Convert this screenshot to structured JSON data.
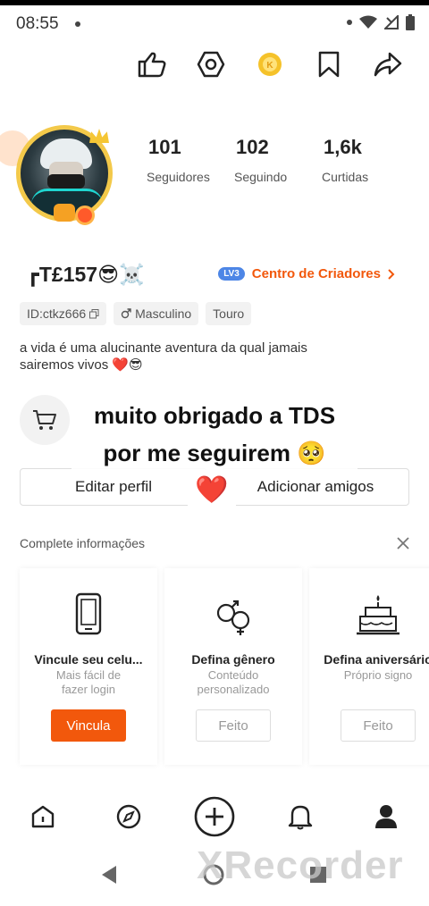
{
  "status_bar": {
    "time": "08:55"
  },
  "header": {
    "icons": [
      "thumbs-up-icon",
      "settings-hexagon-icon",
      "coin-icon",
      "bookmark-icon",
      "share-icon"
    ]
  },
  "stats": [
    {
      "value": "101",
      "label": "Seguidores"
    },
    {
      "value": "102",
      "label": "Seguindo"
    },
    {
      "value": "1,6k",
      "label": "Curtidas"
    }
  ],
  "profile": {
    "username": "┏T£157😎☠️",
    "level_badge": "LV3",
    "creator_center": "Centro de Criadores",
    "tags": {
      "id": "ID:ctkz666",
      "gender": "Masculino",
      "sign": "Touro"
    },
    "bio_line1": "a vida é uma alucinante aventura da qual jamais",
    "bio_line2": "sairemos vivos ❤️😎"
  },
  "buttons": {
    "edit": "Editar perfil",
    "add_friends": "Adicionar amigos"
  },
  "overlay": {
    "line1": "muito obrigado a TDS",
    "line2": "por me seguirem 🥺",
    "heart": "❤️"
  },
  "complete": {
    "title": "Complete informações",
    "cards": [
      {
        "title": "Vincule seu celu...",
        "sub1": "Mais fácil de",
        "sub2": "fazer  login",
        "button": "Vincula"
      },
      {
        "title": "Defina gênero",
        "sub1": "Conteúdo",
        "sub2": "personalizado",
        "button": "Feito"
      },
      {
        "title": "Defina aniversário",
        "sub1": "Próprio signo",
        "sub2": "",
        "button": "Feito"
      }
    ]
  },
  "watermark": "XRecorder"
}
